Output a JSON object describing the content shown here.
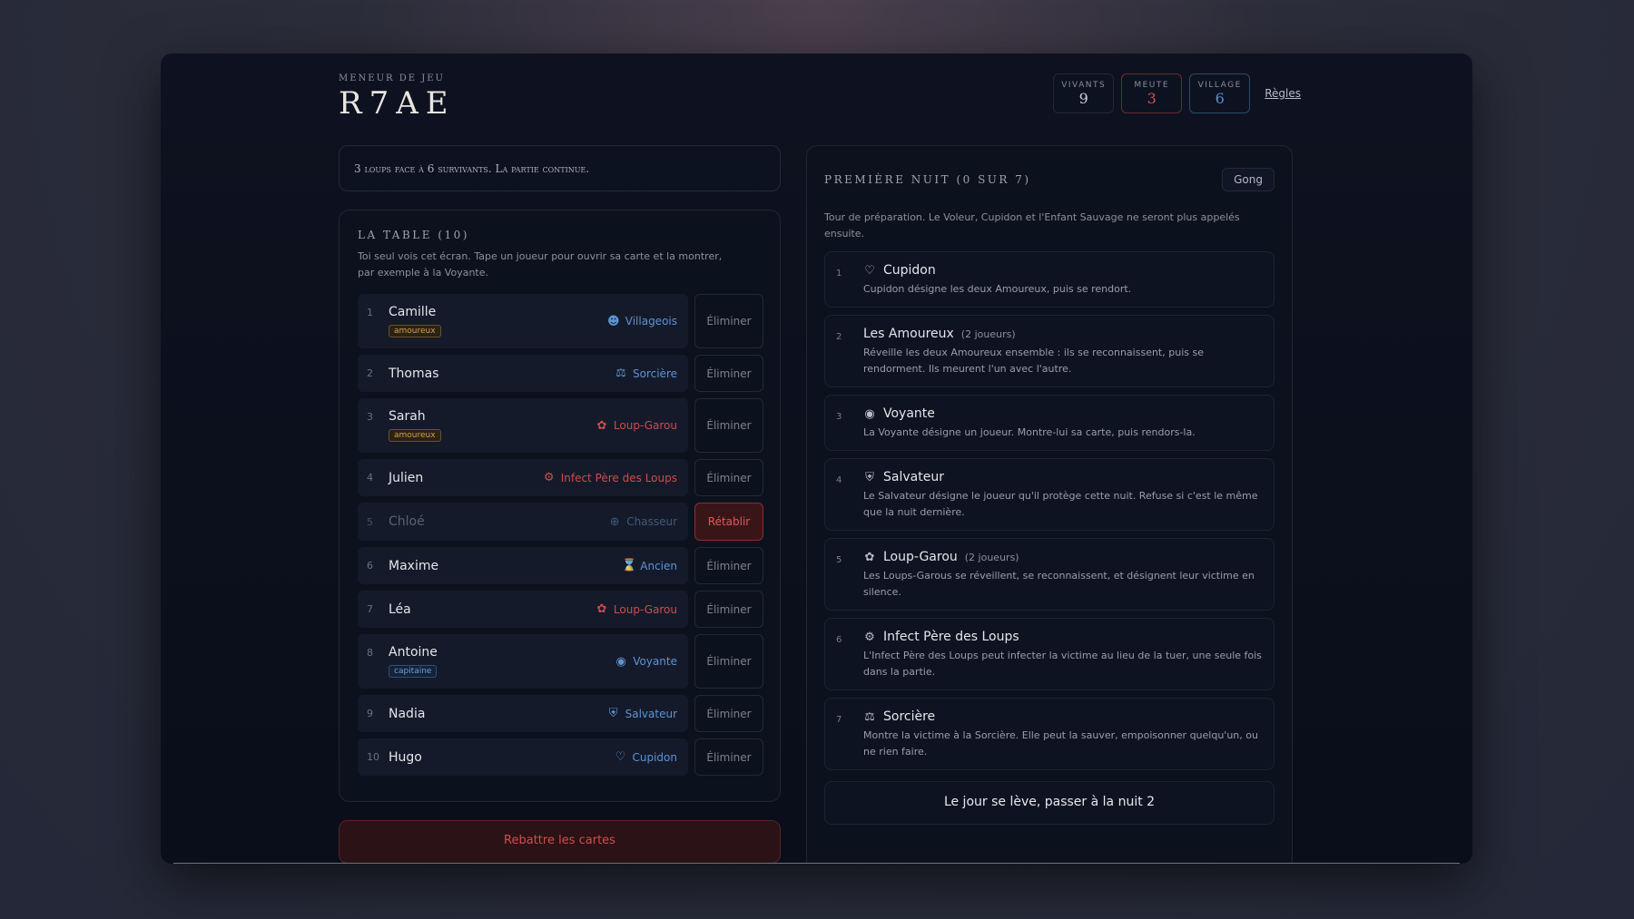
{
  "header": {
    "subtitle": "Meneur de jeu",
    "logo": "R7AE",
    "stats": [
      {
        "label": "Vivants",
        "value": "9"
      },
      {
        "label": "Meute",
        "value": "3"
      },
      {
        "label": "Village",
        "value": "6"
      }
    ],
    "rules_link": "Règles"
  },
  "banner": "3 loups face à 6 survivants. La partie continue.",
  "table": {
    "title": "La table (10)",
    "description": "Toi seul vois cet écran. Tape un joueur pour ouvrir sa carte et la montrer, par exemple à la Voyante.",
    "players": [
      {
        "num": "1",
        "name": "Camille",
        "badge": "amoureux",
        "role": "Villageois",
        "icon": "person-icon",
        "action": "Éliminer"
      },
      {
        "num": "2",
        "name": "Thomas",
        "badge": "",
        "role": "Sorcière",
        "icon": "flask-icon",
        "action": "Éliminer"
      },
      {
        "num": "3",
        "name": "Sarah",
        "badge": "amoureux",
        "role": "Loup-Garou",
        "icon": "paw-icon",
        "action": "Éliminer"
      },
      {
        "num": "4",
        "name": "Julien",
        "badge": "",
        "role": "Infect Père des Loups",
        "icon": "virus-icon",
        "action": "Éliminer"
      },
      {
        "num": "5",
        "name": "Chloé",
        "badge": "",
        "role": "Chasseur",
        "icon": "crosshair-icon",
        "action": "Rétablir"
      },
      {
        "num": "6",
        "name": "Maxime",
        "badge": "",
        "role": "Ancien",
        "icon": "hourglass-icon",
        "action": "Éliminer"
      },
      {
        "num": "7",
        "name": "Léa",
        "badge": "",
        "role": "Loup-Garou",
        "icon": "paw-icon",
        "action": "Éliminer"
      },
      {
        "num": "8",
        "name": "Antoine",
        "badge": "capitaine",
        "role": "Voyante",
        "icon": "eye-icon",
        "action": "Éliminer"
      },
      {
        "num": "9",
        "name": "Nadia",
        "badge": "",
        "role": "Salvateur",
        "icon": "shield-icon",
        "action": "Éliminer"
      },
      {
        "num": "10",
        "name": "Hugo",
        "badge": "",
        "role": "Cupidon",
        "icon": "heart-icon",
        "action": "Éliminer"
      }
    ]
  },
  "redeal_button": "Rebattre les cartes",
  "night": {
    "title": "Première nuit (0 sur 7)",
    "gong": "Gong",
    "description": "Tour de préparation. Le Voleur, Cupidon et l'Enfant Sauvage ne seront plus appelés ensuite.",
    "steps": [
      {
        "num": "1",
        "title": "Cupidon",
        "extra": "",
        "icon": "heart-icon",
        "text": "Cupidon désigne les deux Amoureux, puis se rendort."
      },
      {
        "num": "2",
        "title": "Les Amoureux",
        "extra": "(2 joueurs)",
        "icon": "",
        "text": "Réveille les deux Amoureux ensemble : ils se reconnaissent, puis se rendorment. Ils meurent l'un avec l'autre."
      },
      {
        "num": "3",
        "title": "Voyante",
        "extra": "",
        "icon": "eye-icon",
        "text": "La Voyante désigne un joueur. Montre-lui sa carte, puis rendors-la."
      },
      {
        "num": "4",
        "title": "Salvateur",
        "extra": "",
        "icon": "shield-icon",
        "text": "Le Salvateur désigne le joueur qu'il protège cette nuit. Refuse si c'est le même que la nuit dernière."
      },
      {
        "num": "5",
        "title": "Loup-Garou",
        "extra": "(2 joueurs)",
        "icon": "paw-icon",
        "text": "Les Loups-Garous se réveillent, se reconnaissent, et désignent leur victime en silence."
      },
      {
        "num": "6",
        "title": "Infect Père des Loups",
        "extra": "",
        "icon": "virus-icon",
        "text": "L'Infect Père des Loups peut infecter la victime au lieu de la tuer, une seule fois dans la partie."
      },
      {
        "num": "7",
        "title": "Sorcière",
        "extra": "",
        "icon": "flask-icon",
        "text": "Montre la victime à la Sorcière. Elle peut la sauver, empoisonner quelqu'un, ou ne rien faire."
      }
    ],
    "next_button": "Le jour se lève, passer à la nuit 2"
  },
  "colors": {
    "accent_red": "#d04c4a",
    "accent_blue": "#5e93d4",
    "badge_gold": "#d4a24e"
  }
}
